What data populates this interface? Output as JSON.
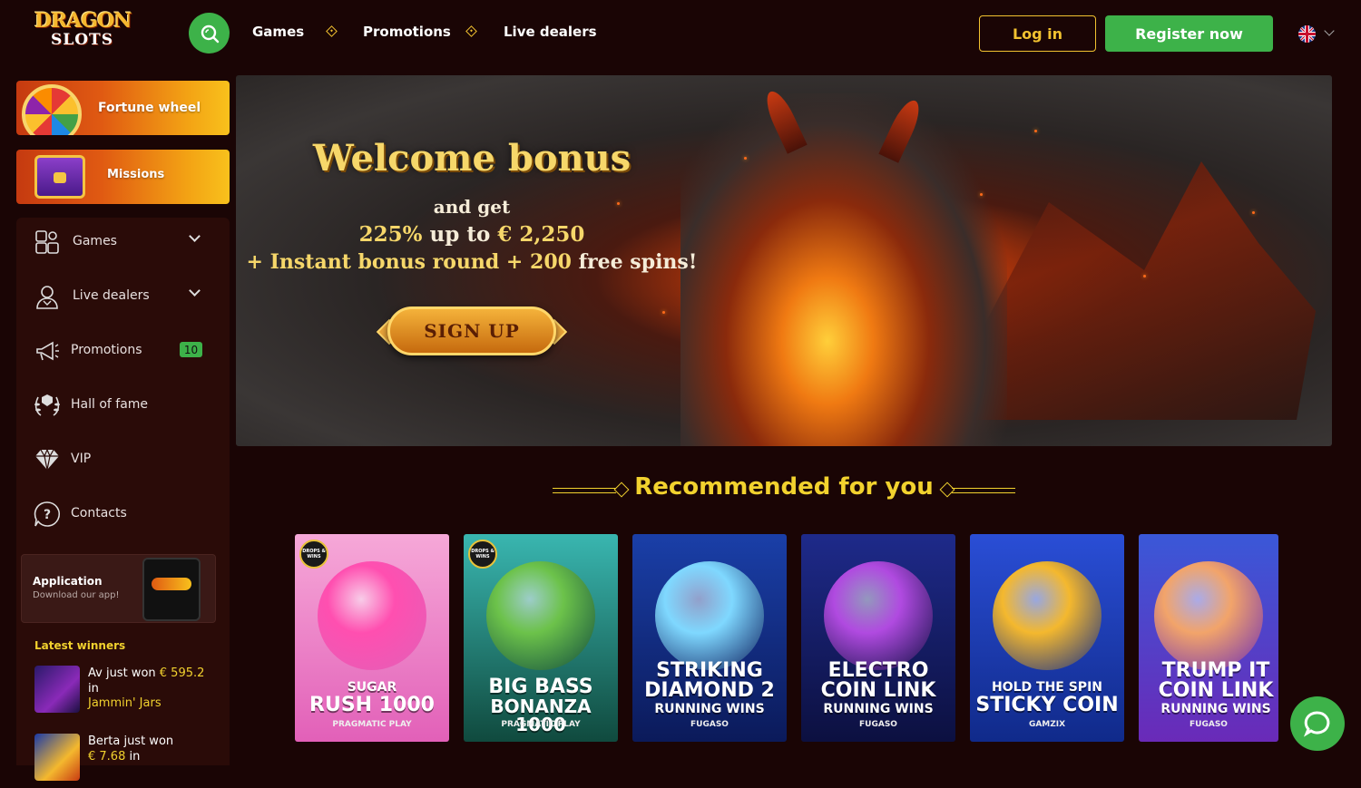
{
  "brand": {
    "line1": "DRAGON",
    "line2": "SLOTS"
  },
  "nav": {
    "items": [
      "Games",
      "Promotions",
      "Live dealers"
    ]
  },
  "auth": {
    "login": "Log in",
    "register": "Register now"
  },
  "sidebar": {
    "promos": [
      {
        "label": "Fortune wheel",
        "icon": "fortune-wheel-icon"
      },
      {
        "label": "Missions",
        "icon": "treasure-chest-icon"
      }
    ],
    "menu": [
      {
        "label": "Games",
        "icon": "games-icon",
        "dropdown": true
      },
      {
        "label": "Live dealers",
        "icon": "live-dealer-icon",
        "dropdown": true
      },
      {
        "label": "Promotions",
        "icon": "megaphone-icon",
        "badge": "10"
      },
      {
        "label": "Hall of fame",
        "icon": "laurel-icon"
      },
      {
        "label": "VIP",
        "icon": "diamond-icon"
      },
      {
        "label": "Contacts",
        "icon": "question-icon"
      }
    ],
    "app": {
      "title": "Application",
      "subtitle": "Download our app!"
    },
    "latest_winners": {
      "title": "Latest winners",
      "items": [
        {
          "name": "Av just won",
          "amount": "€ 595.2",
          "in": "in",
          "game": "Jammin' Jars"
        },
        {
          "name": "Berta just won",
          "amount": "€ 7.68",
          "in": "in",
          "game": ""
        }
      ]
    }
  },
  "banner": {
    "title": "Welcome bonus",
    "line2": "and get",
    "line3_highlight": "225%",
    "line3_rest": " up to ",
    "line3_amount": "€ 2,250",
    "line4_a": "+ Instant bonus round + 200 ",
    "line4_b": "free spins!",
    "cta": "SIGN UP"
  },
  "recommended": {
    "title": "Recommended for you",
    "games": [
      {
        "l1": "SUGAR",
        "l2": "RUSH 1000",
        "l3": "",
        "provider": "PRAGMATIC PLAY",
        "drops": "DROPS & WINS",
        "bg1": "#f6a8d8",
        "bg2": "#e260b8",
        "art": "#ff4fb0"
      },
      {
        "l1": "BIG BASS",
        "l2": "BONANZA 1000",
        "l3": "",
        "provider": "PRAGMATIC PLAY",
        "drops": "DROPS & WINS",
        "bg1": "#39b6b0",
        "bg2": "#104a3e",
        "art": "#6cc24a"
      },
      {
        "l1": "STRIKING",
        "l2": "DIAMOND 2",
        "l3": "RUNNING WINS",
        "provider": "FUGASO",
        "drops": "",
        "bg1": "#1a3fa8",
        "bg2": "#0b1a5a",
        "art": "#7fd8ff"
      },
      {
        "l1": "ELECTRO",
        "l2": "COIN LINK",
        "l3": "RUNNING WINS",
        "provider": "FUGASO",
        "drops": "",
        "bg1": "#1e2a8a",
        "bg2": "#0c1040",
        "art": "#b04ae0"
      },
      {
        "l1": "HOLD THE SPIN",
        "l2": "STICKY COIN",
        "l3": "",
        "provider": "GAMZIX",
        "drops": "",
        "bg1": "#2a4ed6",
        "bg2": "#102a8a",
        "art": "#f4b82e"
      },
      {
        "l1": "TRUMP IT",
        "l2": "COIN LINK",
        "l3": "RUNNING WINS",
        "provider": "FUGASO",
        "drops": "",
        "bg1": "#3a58d8",
        "bg2": "#6a2ab8",
        "art": "#f2a46a"
      }
    ]
  },
  "colors": {
    "accent": "#f2d22e",
    "green": "#3db249",
    "bg": "#1a0505"
  }
}
